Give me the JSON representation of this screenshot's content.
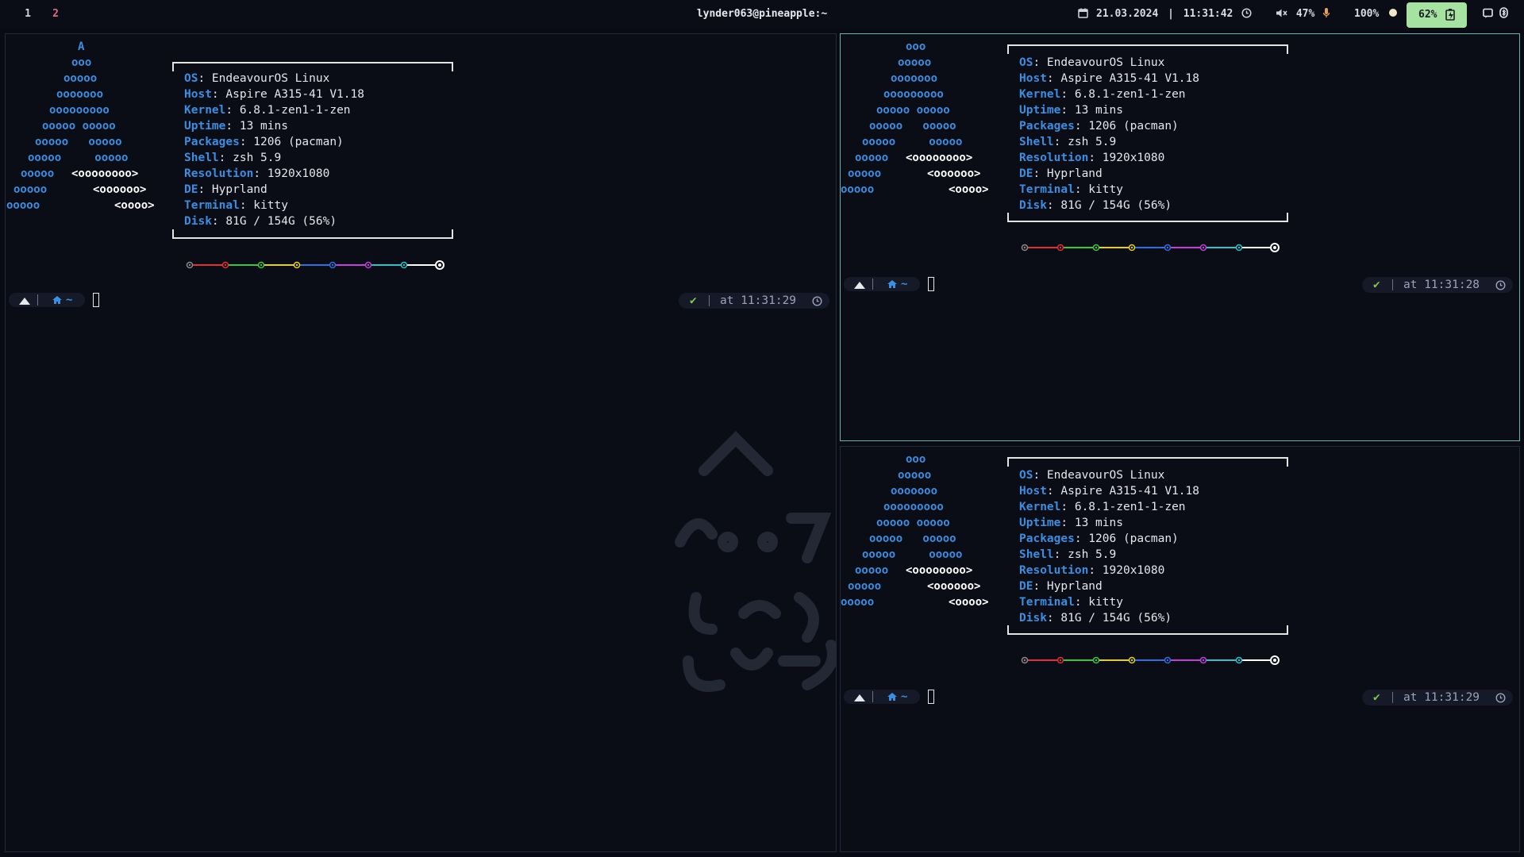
{
  "topbar": {
    "workspaces": [
      "1",
      "2"
    ],
    "window_title": "lynder063@pineapple:~",
    "date": "21.03.2024",
    "separator": "|",
    "time": "11:31:42",
    "volume": "47%",
    "brightness": "100%",
    "battery": "62%",
    "icons": [
      "calendar-icon",
      "clock-icon",
      "speaker-muted-icon",
      "microphone-icon",
      "brightness-icon",
      "battery-charging-icon",
      "notification-icon",
      "bluetooth-icon"
    ]
  },
  "logo": {
    "left": [
      "A",
      "ooo",
      "ooooo",
      "ooooooo",
      "ooooooooo",
      "ooooo ooooo",
      "ooooo   ooooo",
      "ooooo     ooooo",
      "ooooo  ",
      "ooooo       ",
      "ooooo          "
    ],
    "left_white": [
      "",
      "",
      "",
      "",
      "",
      "",
      "",
      "",
      "<oooooooo>",
      "<oooooo>",
      "<oooo>"
    ],
    "right": [
      "ooo",
      "ooooo",
      "ooooooo",
      "ooooooooo",
      "ooooo ooooo",
      "ooooo   ooooo",
      "ooooo     ooooo",
      "ooooo  ",
      "ooooo       ",
      "ooooo          "
    ],
    "right_white": [
      "",
      "",
      "",
      "",
      "",
      "",
      "",
      "<oooooooo>",
      "<oooooo>",
      "<oooo>"
    ]
  },
  "fetch": {
    "rows": [
      {
        "key": "OS",
        "value": ": EndeavourOS Linux"
      },
      {
        "key": "Host",
        "value": ": Aspire A315-41 V1.18"
      },
      {
        "key": "Kernel",
        "value": ": 6.8.1-zen1-1-zen"
      },
      {
        "key": "Uptime",
        "value": ": 13 mins"
      },
      {
        "key": "Packages",
        "value": ": 1206 (pacman)"
      },
      {
        "key": "Shell",
        "value": ": zsh 5.9"
      },
      {
        "key": "Resolution",
        "value": ": 1920x1080"
      },
      {
        "key": "DE",
        "value": ": Hyprland"
      },
      {
        "key": "Terminal",
        "value": ": kitty"
      },
      {
        "key": "Disk",
        "value": ": 81G / 154G (56%)"
      }
    ],
    "palette": [
      "#8a8a8a",
      "#e0303a",
      "#3ec43e",
      "#e5d020",
      "#2f6fe0",
      "#c040d8",
      "#30c0c8",
      "#ffffff"
    ]
  },
  "prompt": {
    "home_symbol": "~",
    "check": "✔",
    "terminals": [
      {
        "time": "at 11:31:29"
      },
      {
        "time": "at 11:31:28"
      },
      {
        "time": "at 11:31:29"
      }
    ]
  }
}
